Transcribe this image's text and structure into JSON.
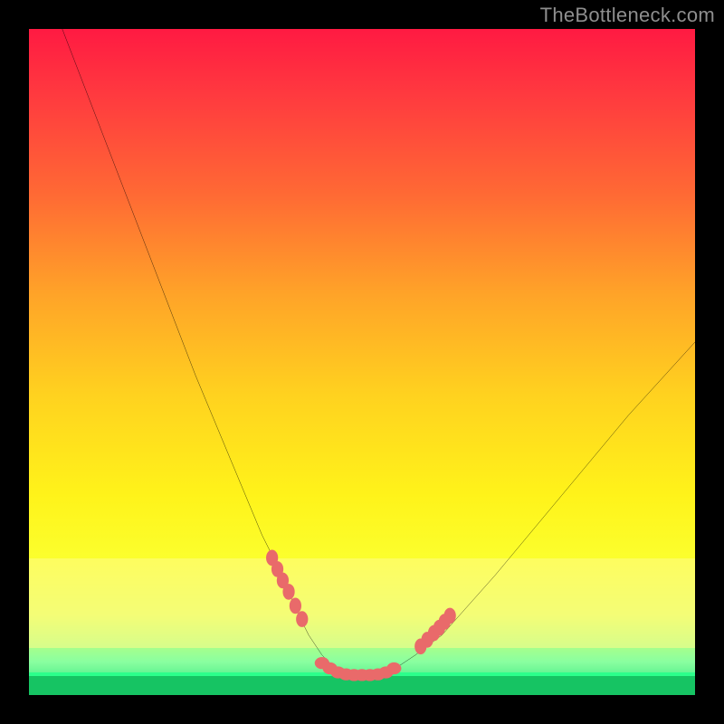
{
  "watermark": "TheBottleneck.com",
  "colors": {
    "frame": "#000000",
    "curve": "#000000",
    "markers": "#e96a6a",
    "green_line": "#2cff8b",
    "green_base": "#16c463"
  },
  "chart_data": {
    "type": "line",
    "title": "",
    "xlabel": "",
    "ylabel": "",
    "xlim": [
      0,
      100
    ],
    "ylim": [
      0,
      100
    ],
    "grid": false,
    "legend": false,
    "note": "No axis ticks or numeric labels are rendered in the image; values estimated from pixel position on a 0–100 normalized coordinate system (x left→right, y bottom→top).",
    "series": [
      {
        "name": "bottleneck-curve",
        "x": [
          5,
          10,
          15,
          20,
          25,
          30,
          35,
          38,
          40,
          42,
          44,
          46,
          48,
          50,
          52,
          55,
          58,
          62,
          70,
          80,
          90,
          100
        ],
        "y": [
          100,
          87,
          74,
          61,
          48,
          36,
          24,
          18,
          13,
          9,
          6,
          4,
          3,
          3,
          3,
          4,
          6,
          9,
          18,
          30,
          42,
          53
        ]
      }
    ],
    "markers": {
      "name": "highlighted-points",
      "note": "Salmon dotted segments near the curve minimum and flanks.",
      "x": [
        36.5,
        37.3,
        38.1,
        39.0,
        40.0,
        41.0,
        44.0,
        45.2,
        46.4,
        47.6,
        48.8,
        50.0,
        51.2,
        52.4,
        53.6,
        54.8,
        58.8,
        59.8,
        60.8,
        61.6,
        62.4,
        63.2
      ],
      "y": [
        20.6,
        18.9,
        17.2,
        15.5,
        13.4,
        11.4,
        4.8,
        4.0,
        3.4,
        3.1,
        3.0,
        3.0,
        3.0,
        3.1,
        3.4,
        4.0,
        7.3,
        8.3,
        9.3,
        10.1,
        11.0,
        11.9
      ]
    }
  }
}
